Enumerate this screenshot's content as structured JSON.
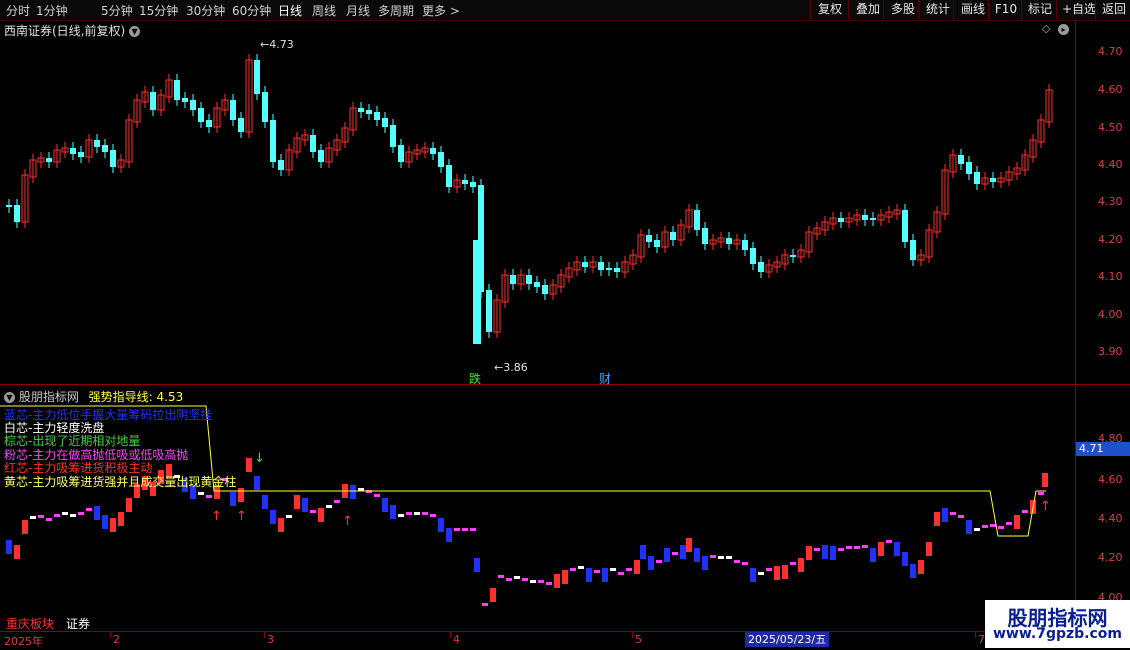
{
  "toolbar": {
    "periods": [
      "分时",
      "1分钟",
      "5分钟",
      "15分钟",
      "30分钟",
      "60分钟",
      "日线",
      "周线",
      "月线",
      "多周期",
      "更多 >"
    ],
    "active_period": "日线",
    "buttons": [
      "复权",
      "叠加",
      "多股",
      "统计",
      "画线",
      "F10",
      "标记",
      "+自选",
      "返回"
    ]
  },
  "main_chart": {
    "title": "西南证券(日线,前复权)",
    "y_ticks": [
      "4.70",
      "4.60",
      "4.50",
      "4.40",
      "4.30",
      "4.20",
      "4.10",
      "4.00",
      "3.90"
    ],
    "high_label": "4.73",
    "low_label": "3.86",
    "event_markers": [
      "跌",
      "财"
    ]
  },
  "indicator": {
    "title": "股朋指标网",
    "line_label": "强势指导线:",
    "line_value": "4.53",
    "current_price": "4.71",
    "y_ticks": [
      "4.80",
      "4.60",
      "4.40",
      "4.20",
      "4.00"
    ],
    "legend": [
      {
        "text": "蓝芯-主力低位手握大量筹码拉出阴坚挂",
        "color": "#2030ff"
      },
      {
        "text": "白芯-主力轻度洗盘",
        "color": "#ffffff"
      },
      {
        "text": "棕芯-出现了近期相对地量",
        "color": "#40d040"
      },
      {
        "text": "粉芯-主力在做高抛低吸或低吸高抛",
        "color": "#ff40ff"
      },
      {
        "text": "红芯-主力吸筹进货积极主动",
        "color": "#ff3030"
      },
      {
        "text": "黄芯-主力吸筹进货强并且成交量出现黄金柱",
        "color": "#ffff60"
      }
    ]
  },
  "bottom_tabs": [
    "重庆板块",
    "证券"
  ],
  "time_axis": {
    "labels": [
      "2025年",
      "2",
      "3",
      "4",
      "5",
      "7"
    ],
    "cursor_date": "2025/05/23/五"
  },
  "watermark": {
    "title": "股朋指标网",
    "url": "www.7gpzb.com"
  },
  "colors": {
    "up": "#ff3030",
    "down": "#54ffff",
    "axis": "#8b0000",
    "guide": "#ffff40"
  }
}
